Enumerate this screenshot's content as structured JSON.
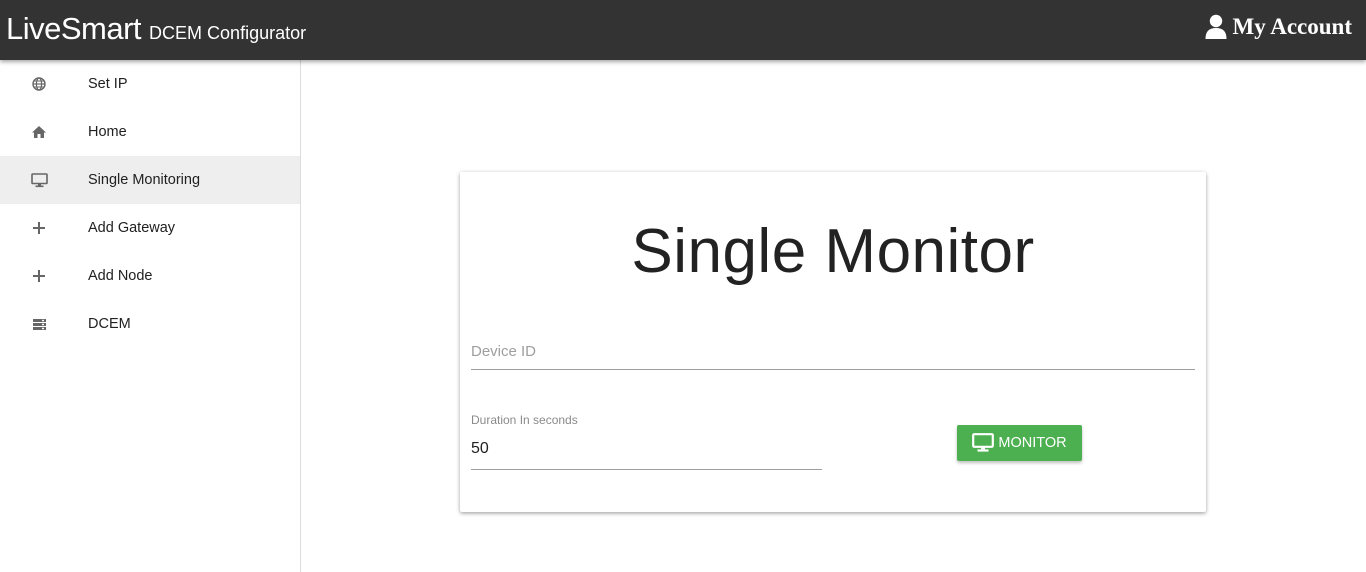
{
  "app": {
    "brand": "LiveSmart",
    "subtitle": "DCEM Configurator",
    "account_label": "My Account",
    "account_icon": "user-icon"
  },
  "sidebar": {
    "items": [
      {
        "label": "Set IP",
        "icon": "globe-icon",
        "active": false
      },
      {
        "label": "Home",
        "icon": "home-icon",
        "active": false
      },
      {
        "label": "Single Monitoring",
        "icon": "desktop-icon",
        "active": true
      },
      {
        "label": "Add Gateway",
        "icon": "plus-icon",
        "active": false
      },
      {
        "label": "Add Node",
        "icon": "plus-icon",
        "active": false
      },
      {
        "label": "DCEM",
        "icon": "server-icon",
        "active": false
      }
    ]
  },
  "card": {
    "title": "Single Monitor",
    "device_id": {
      "placeholder": "Device ID",
      "value": ""
    },
    "duration": {
      "label": "Duration In seconds",
      "value": "50"
    },
    "monitor_button": {
      "label": "MONITOR",
      "icon": "desktop-icon"
    }
  },
  "colors": {
    "topbar": "#333333",
    "button": "#4caf50",
    "active_item": "#eeeeee"
  }
}
